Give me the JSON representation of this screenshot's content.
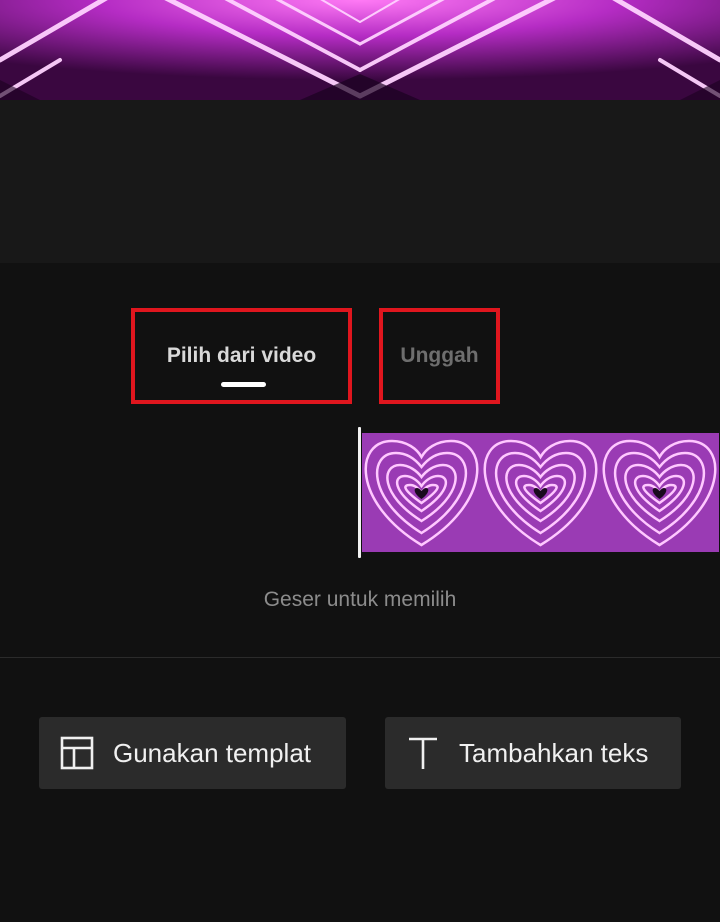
{
  "tabs": [
    {
      "label": "Pilih dari video",
      "active": true
    },
    {
      "label": "Unggah",
      "active": false
    }
  ],
  "hint": "Geser untuk memilih",
  "actions": {
    "template_label": "Gunakan templat",
    "text_label": "Tambahkan teks"
  },
  "colors": {
    "highlight": "#e0161e",
    "active_tab": "#d9d9d9",
    "inactive_tab": "#6e6e6e",
    "neon": "#e040fb"
  },
  "icons": {
    "template": "layout-template-icon",
    "text": "text-t-icon"
  }
}
